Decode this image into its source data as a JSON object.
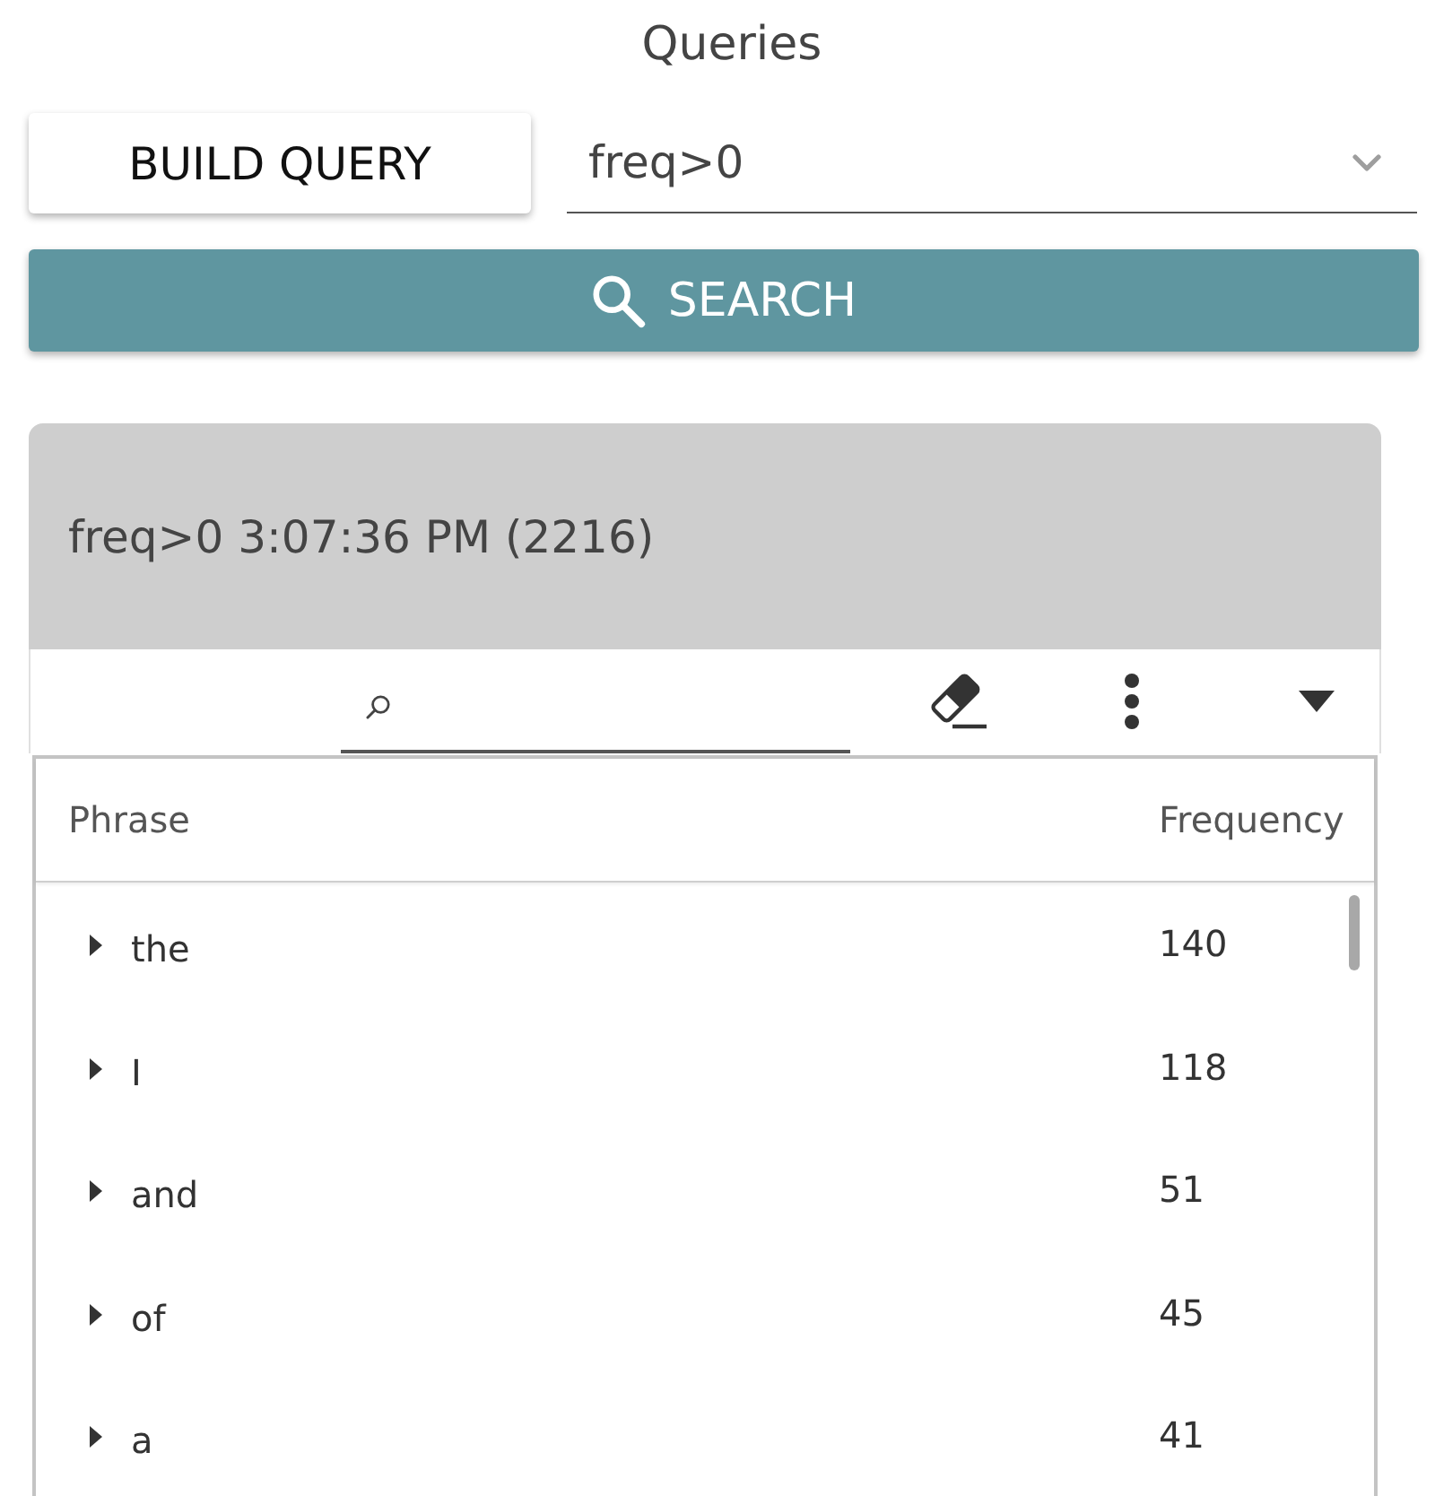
{
  "title": "Queries",
  "build_query_button": {
    "label": "BUILD QUERY"
  },
  "query_select": {
    "value": "freq>0"
  },
  "search_button": {
    "label": "SEARCH"
  },
  "result_panel": {
    "title": "freq>0 3:07:36 PM (2216)",
    "table": {
      "columns": [
        "Phrase",
        "Frequency"
      ],
      "rows": [
        {
          "phrase": "the",
          "frequency": "140",
          "expanded": false
        },
        {
          "phrase": "I",
          "frequency": "118",
          "expanded": false
        },
        {
          "phrase": "and",
          "frequency": "51",
          "expanded": false
        },
        {
          "phrase": "of",
          "frequency": "45",
          "expanded": false
        },
        {
          "phrase": "a",
          "frequency": "41",
          "expanded": false
        }
      ]
    }
  }
}
